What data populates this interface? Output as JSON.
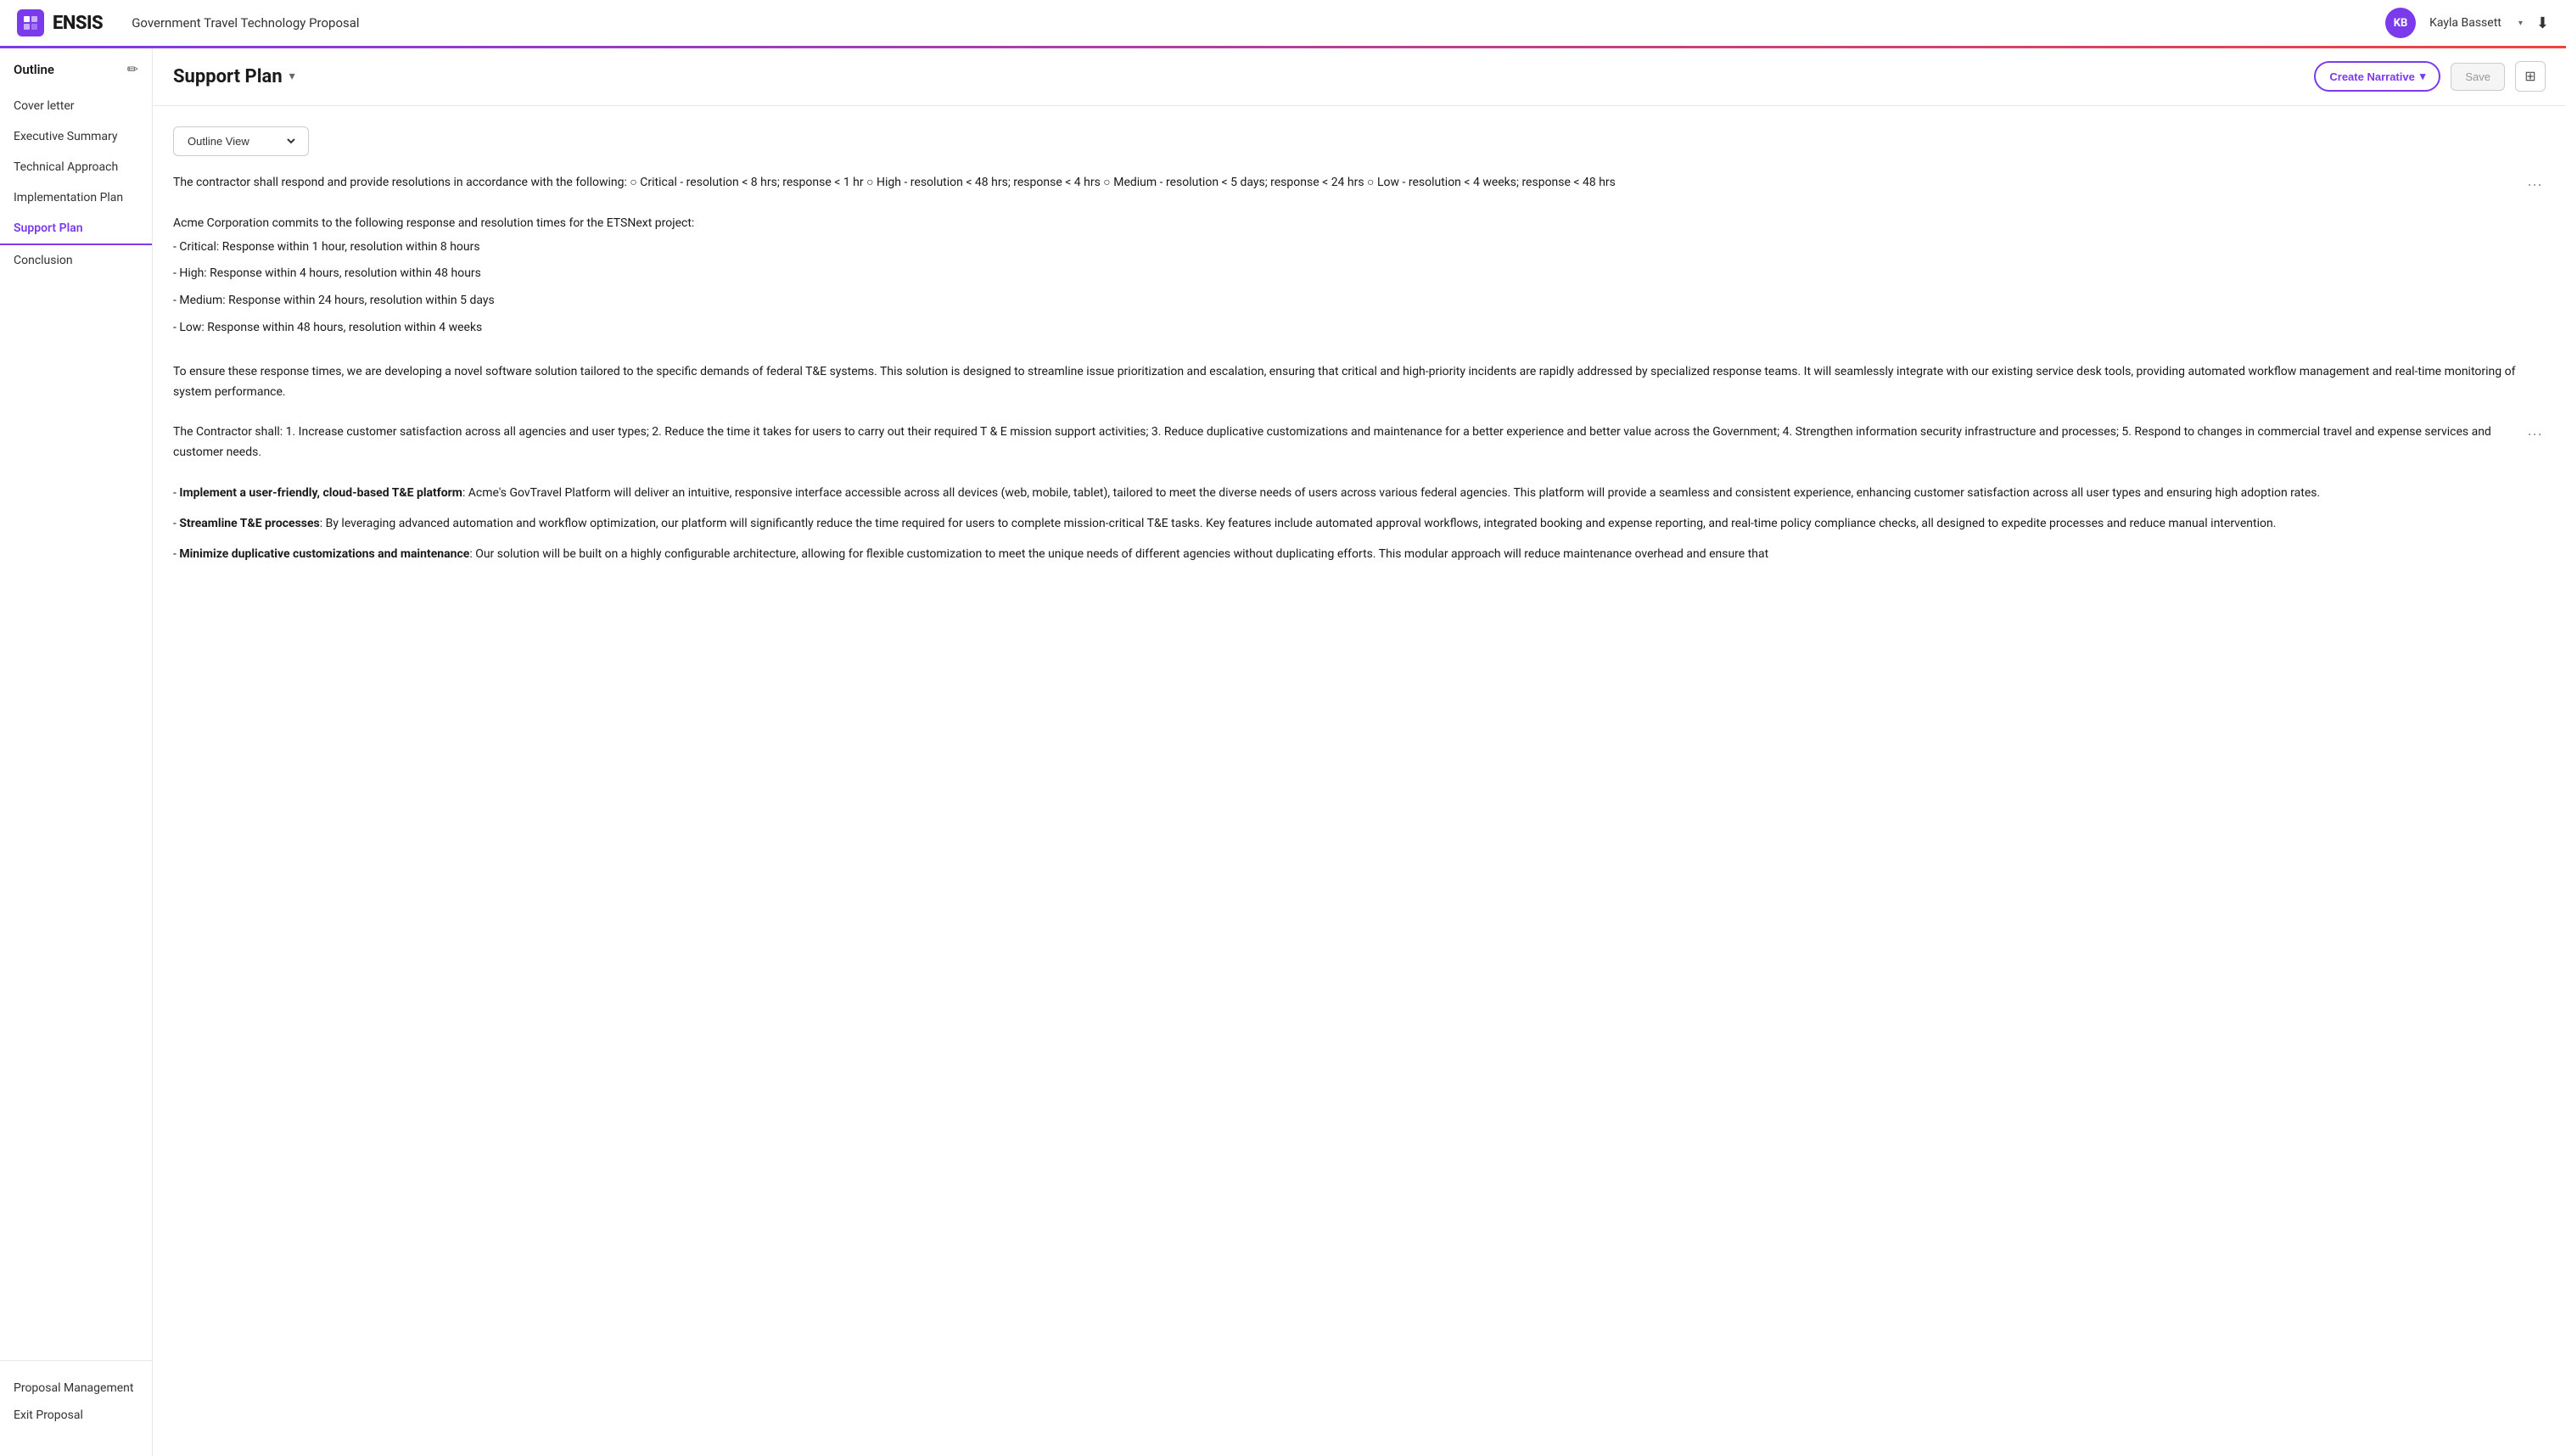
{
  "header": {
    "logo_icon": "e",
    "logo_text": "ENSIS",
    "project_title": "Government Travel Technology Proposal",
    "user_initials": "KB",
    "user_name": "Kayla Bassett"
  },
  "sidebar": {
    "title": "Outline",
    "items": [
      {
        "id": "cover-letter",
        "label": "Cover letter",
        "active": false
      },
      {
        "id": "executive-summary",
        "label": "Executive Summary",
        "active": false
      },
      {
        "id": "technical-approach",
        "label": "Technical Approach",
        "active": false
      },
      {
        "id": "implementation-plan",
        "label": "Implementation Plan",
        "active": false
      },
      {
        "id": "support-plan",
        "label": "Support Plan",
        "active": true
      },
      {
        "id": "conclusion",
        "label": "Conclusion",
        "active": false
      }
    ],
    "footer_items": [
      {
        "id": "proposal-management",
        "label": "Proposal Management"
      },
      {
        "id": "exit-proposal",
        "label": "Exit Proposal"
      }
    ]
  },
  "page": {
    "title": "Support Plan",
    "view_selector_label": "Outline View",
    "create_narrative_label": "Create Narrative",
    "save_label": "Save"
  },
  "content_blocks": [
    {
      "id": "block-1",
      "has_menu": true,
      "type": "paragraph",
      "text": "The contractor shall respond and provide resolutions in accordance with the following: ○ Critical - resolution < 8 hrs; response < 1 hr ○ High - resolution < 48 hrs; response < 4 hrs ○ Medium - resolution < 5 days; response < 24 hrs ○ Low - resolution < 4 weeks; response < 48 hrs"
    },
    {
      "id": "block-2",
      "has_menu": false,
      "type": "list",
      "intro": "Acme Corporation commits to the following response and resolution times for the ETSNext project:",
      "items": [
        "- Critical: Response within 1 hour, resolution within 8 hours",
        "- High: Response within 4 hours, resolution within 48 hours",
        "- Medium: Response within 24 hours, resolution within 5 days",
        "- Low: Response within 48 hours, resolution within 4 weeks"
      ]
    },
    {
      "id": "block-3",
      "has_menu": false,
      "type": "paragraph",
      "text": "To ensure these response times, we are developing a novel software solution tailored to the specific demands of federal T&E systems. This solution is designed to streamline issue prioritization and escalation, ensuring that critical and high-priority incidents are rapidly addressed by specialized response teams. It will seamlessly integrate with our existing service desk tools, providing automated workflow management and real-time monitoring of system performance."
    },
    {
      "id": "block-4",
      "has_menu": true,
      "type": "paragraph",
      "text": "The Contractor shall: 1. Increase customer satisfaction across all agencies and user types; 2. Reduce the time it takes for users to carry out their required T & E mission support activities; 3. Reduce duplicative customizations and maintenance for a better experience and better value across the Government; 4. Strengthen information security infrastructure and processes; 5. Respond to changes in commercial travel and expense services and customer needs."
    },
    {
      "id": "block-5",
      "has_menu": false,
      "type": "rich-list",
      "items": [
        {
          "bold": "Implement a user-friendly, cloud-based T&E platform",
          "text": ": Acme's GovTravel Platform will deliver an intuitive, responsive interface accessible across all devices (web, mobile, tablet), tailored to meet the diverse needs of users across various federal agencies. This platform will provide a seamless and consistent experience, enhancing customer satisfaction across all user types and ensuring high adoption rates."
        },
        {
          "bold": "Streamline T&E processes",
          "text": ": By leveraging advanced automation and workflow optimization, our platform will significantly reduce the time required for users to complete mission-critical T&E tasks. Key features include automated approval workflows, integrated booking and expense reporting, and real-time policy compliance checks, all designed to expedite processes and reduce manual intervention."
        },
        {
          "bold": "Minimize duplicative customizations and maintenance",
          "text": ": Our solution will be built on a highly configurable architecture, allowing for flexible customization to meet the unique needs of different agencies without duplicating efforts. This modular approach will reduce maintenance overhead and ensure that"
        }
      ]
    }
  ]
}
